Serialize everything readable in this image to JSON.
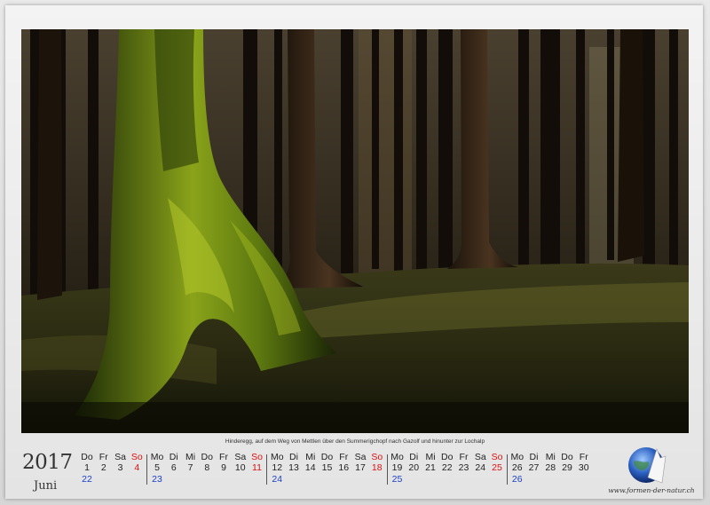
{
  "photo": {
    "caption": "Hinderegg, auf dem Weg von Mettlen über den Summerigchopf nach Gazolf und hinunter zur Lochalp"
  },
  "calendar": {
    "year": "2017",
    "month": "Juni",
    "weekday_labels": [
      "Do",
      "Fr",
      "Sa",
      "So",
      "Mo",
      "Di",
      "Mi",
      "Do",
      "Fr",
      "Sa",
      "So",
      "Mo",
      "Di",
      "Mi",
      "Do",
      "Fr",
      "Sa",
      "So",
      "Mo",
      "Di",
      "Mi",
      "Do",
      "Fr",
      "Sa",
      "So",
      "Mo",
      "Di",
      "Mi",
      "Do",
      "Fr"
    ],
    "days": [
      "1",
      "2",
      "3",
      "4",
      "5",
      "6",
      "7",
      "8",
      "9",
      "10",
      "11",
      "12",
      "13",
      "14",
      "15",
      "16",
      "17",
      "18",
      "19",
      "20",
      "21",
      "22",
      "23",
      "24",
      "25",
      "26",
      "27",
      "28",
      "29",
      "30"
    ],
    "week_numbers": [
      "22",
      "23",
      "24",
      "25",
      "26"
    ],
    "colors": {
      "sunday": "#dd1111",
      "week_number": "#1a3fc8",
      "text": "#222222"
    }
  },
  "branding": {
    "logo_icon": "globe-mountain-icon",
    "website": "www.formen-der-natur.ch"
  }
}
